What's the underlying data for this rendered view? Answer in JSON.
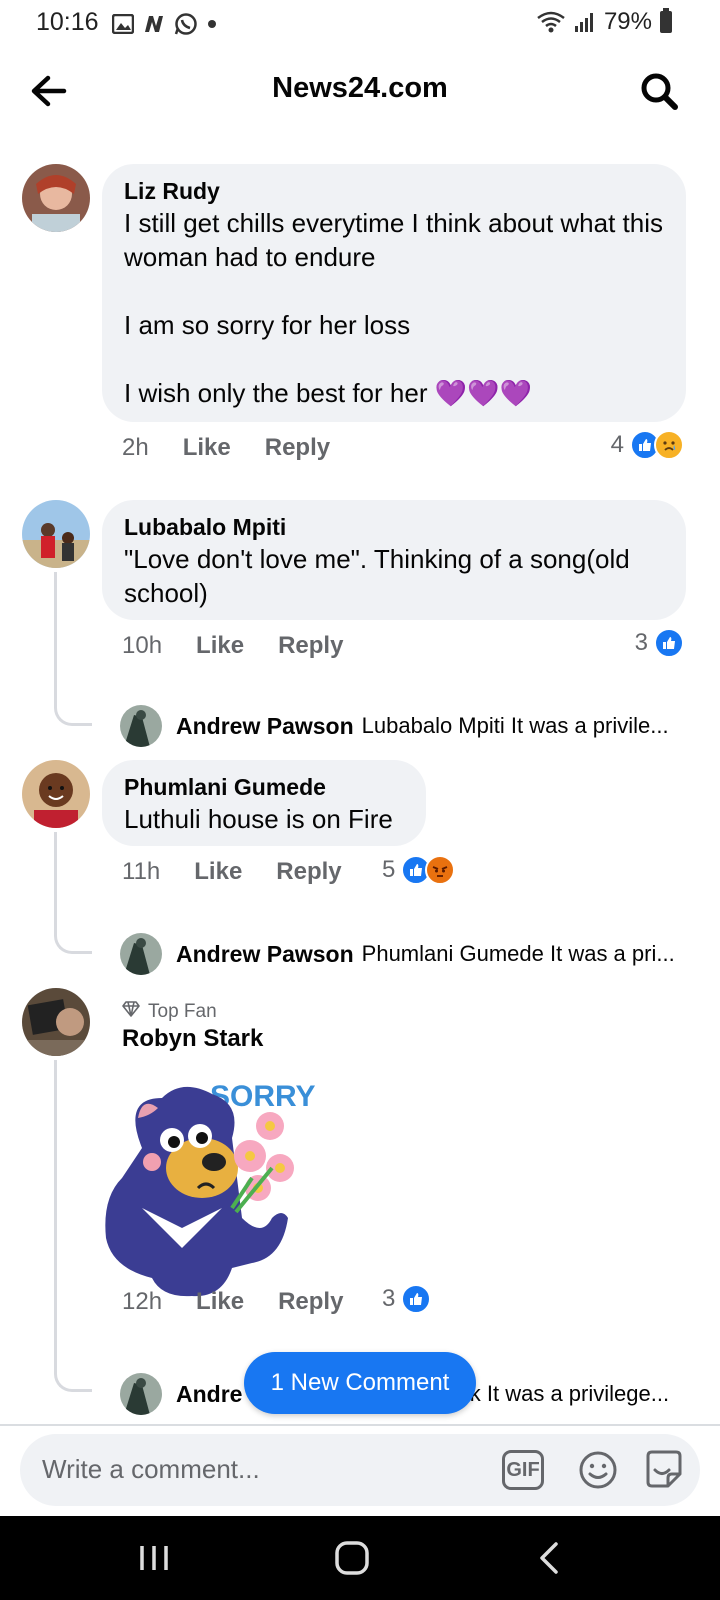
{
  "status": {
    "time": "10:16",
    "battery": "79%"
  },
  "header": {
    "title": "News24.com"
  },
  "comments": [
    {
      "author": "Liz Rudy",
      "text": "I still get chills everytime I think about what this woman had to endure\n\nI am so sorry for her loss\n\nI wish only the best for her 💜💜💜",
      "time": "2h",
      "like_label": "Like",
      "reply_label": "Reply",
      "reaction_count": "4",
      "reactions": [
        "like-icon",
        "sad-icon"
      ]
    },
    {
      "author": "Lubabalo Mpiti",
      "text": "\"Love don't love me\". Thinking of a song(old school)",
      "time": "10h",
      "like_label": "Like",
      "reply_label": "Reply",
      "reaction_count": "3",
      "reactions": [
        "like-icon"
      ],
      "reply_preview": {
        "author": "Andrew Pawson",
        "text": "Lubabalo Mpiti It was a privile..."
      }
    },
    {
      "author": "Phumlani Gumede",
      "text": "Luthuli house is on Fire",
      "time": "11h",
      "like_label": "Like",
      "reply_label": "Reply",
      "reaction_count": "5",
      "reactions": [
        "like-icon",
        "angry-icon"
      ],
      "reply_preview": {
        "author": "Andrew Pawson",
        "text": "Phumlani Gumede It was a pri..."
      }
    },
    {
      "badge": "Top Fan",
      "author": "Robyn Stark",
      "sticker_text": "SORRY",
      "time": "12h",
      "like_label": "Like",
      "reply_label": "Reply",
      "reaction_count": "3",
      "reactions": [
        "like-icon"
      ],
      "reply_preview": {
        "author": "Andre",
        "text": "rk It was a privilege..."
      }
    }
  ],
  "new_comment_label": "1 New Comment",
  "composer": {
    "placeholder": "Write a comment...",
    "gif_label": "GIF"
  },
  "colors": {
    "accent": "#1877f2",
    "bubble": "#f0f2f5",
    "secondary_text": "#65676b"
  }
}
